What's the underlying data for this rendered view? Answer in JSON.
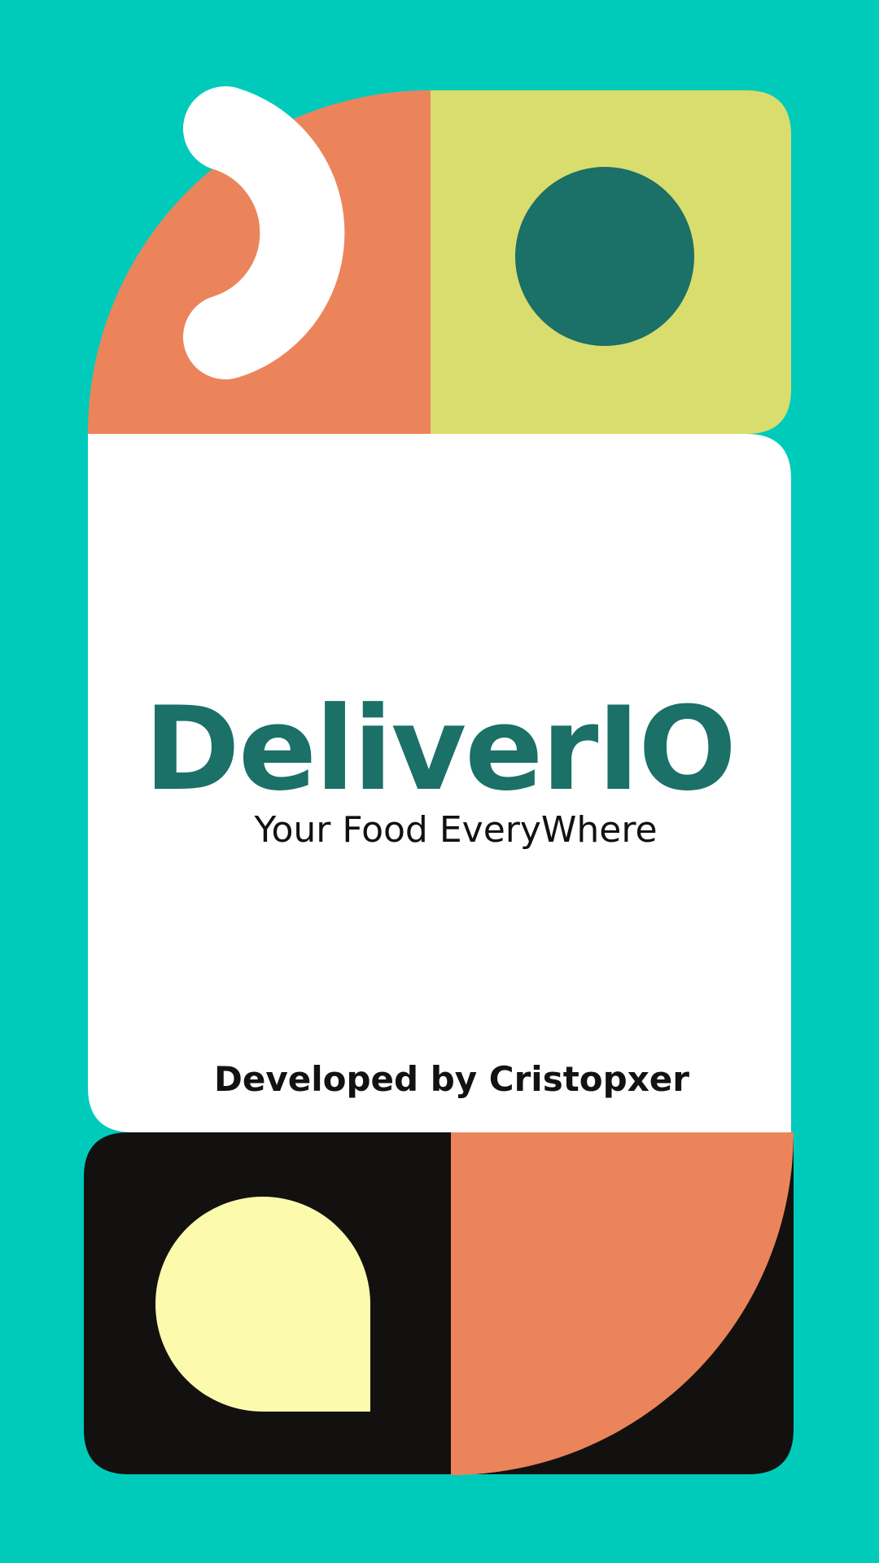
{
  "splash": {
    "title": "DeliverIO",
    "tagline": "Your Food EveryWhere",
    "credit": "Developed by Cristopxer"
  },
  "colors": {
    "background": "#00cbbb",
    "card": "#ffffff",
    "brand_green": "#1b7067",
    "coral": "#ec845b",
    "lime": "#d9dd6d",
    "black": "#121110",
    "cream": "#fcfbad",
    "white": "#ffffff"
  },
  "decorations": {
    "top_left": "crescent-icon",
    "top_right": "circle-icon",
    "bottom_left": "teardrop-icon",
    "bottom_right": "quarter-circle-icon"
  }
}
